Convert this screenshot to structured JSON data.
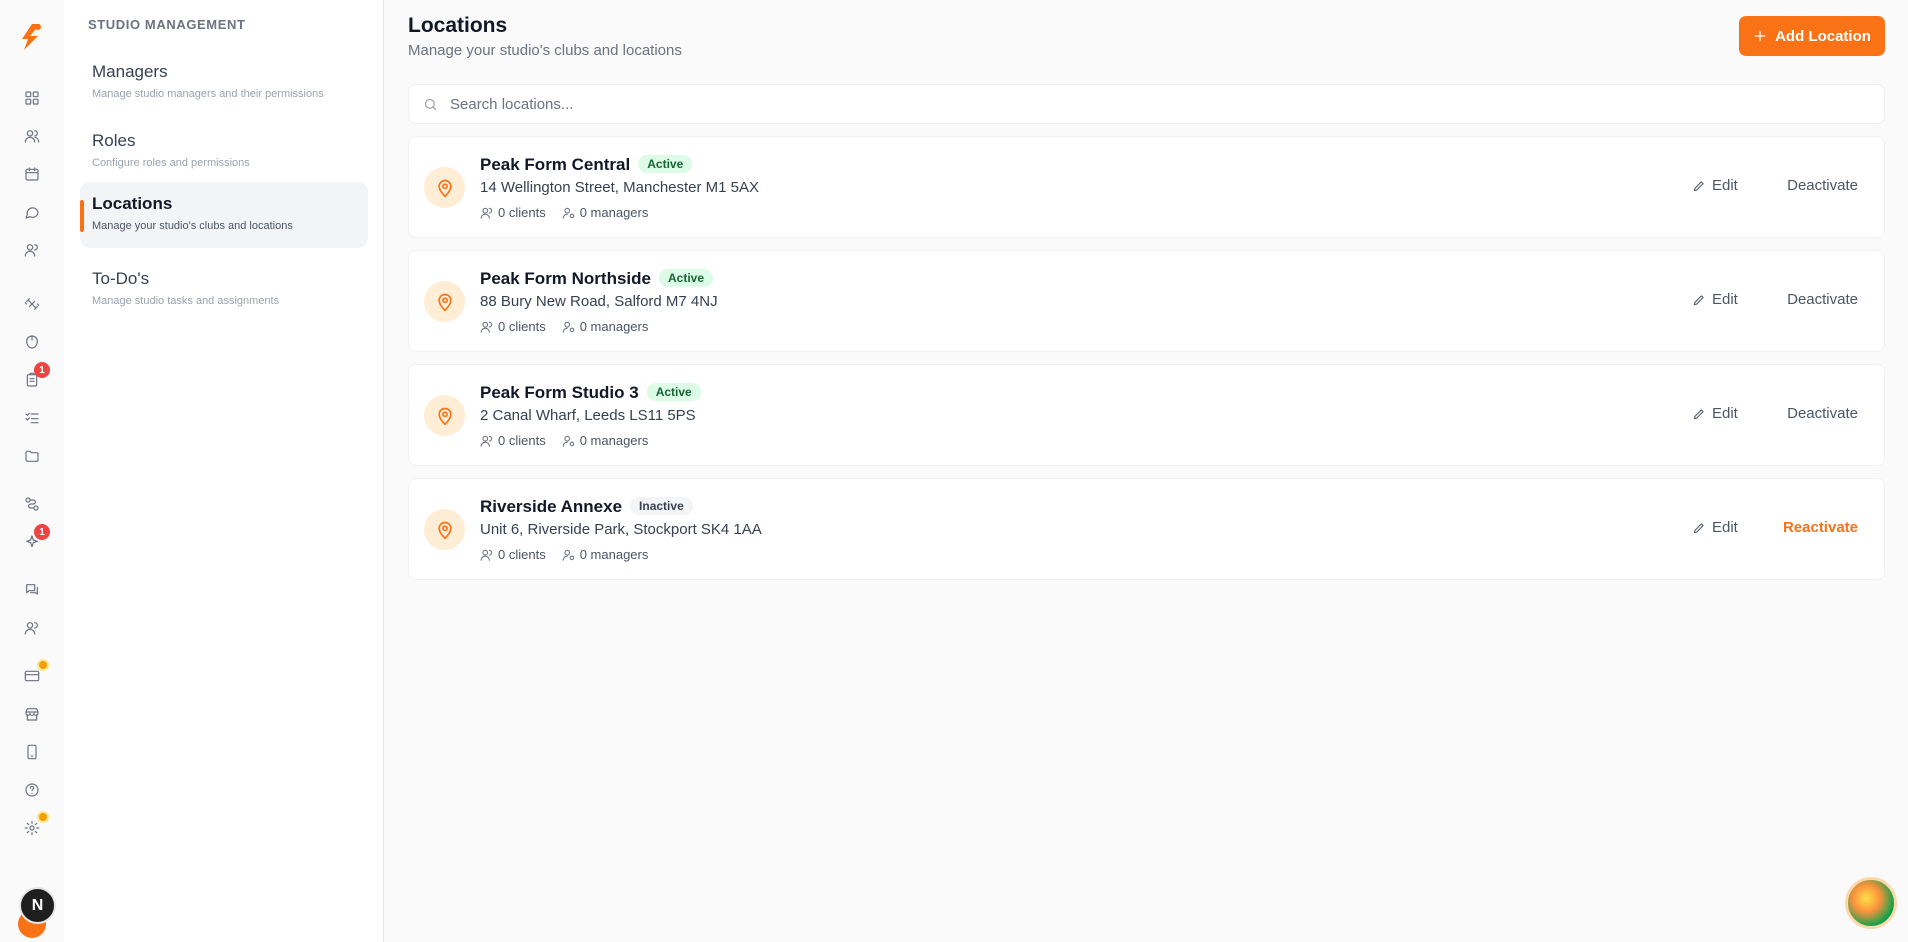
{
  "rail": {
    "icons": [
      "grid-icon",
      "users-icon",
      "calendar-icon",
      "chat-bubble-icon",
      "clients-icon",
      "dumbbell-icon",
      "nutrition-icon",
      "clipboard-icon",
      "checklist-icon",
      "folder-icon",
      "workflow-icon",
      "sparkles-icon",
      "messages-icon",
      "team-icon",
      "credit-card-icon",
      "store-icon",
      "mobile-icon",
      "help-icon",
      "settings-icon"
    ],
    "badges": {
      "clipboard": "1",
      "sparkles": "1"
    },
    "user_initial": "N",
    "accent_color": "#f97316"
  },
  "subnav": {
    "title": "STUDIO MANAGEMENT",
    "items": [
      {
        "label": "Managers",
        "desc": "Manage studio managers and their permissions"
      },
      {
        "label": "Roles",
        "desc": "Configure roles and permissions"
      },
      {
        "label": "Locations",
        "desc": "Manage your studio's clubs and locations"
      },
      {
        "label": "To-Do's",
        "desc": "Manage studio tasks and assignments"
      }
    ]
  },
  "header": {
    "title": "Locations",
    "subtitle": "Manage your studio's clubs and locations",
    "add_button": "Add Location"
  },
  "search": {
    "placeholder": "Search locations..."
  },
  "locations": [
    {
      "name": "Peak Form Central",
      "status": "Active",
      "address": "14 Wellington Street, Manchester M1 5AX",
      "clients": "0 clients",
      "managers": "0 managers",
      "edit": "Edit",
      "action": "Deactivate"
    },
    {
      "name": "Peak Form Northside",
      "status": "Active",
      "address": "88 Bury New Road, Salford M7 4NJ",
      "clients": "0 clients",
      "managers": "0 managers",
      "edit": "Edit",
      "action": "Deactivate"
    },
    {
      "name": "Peak Form Studio 3",
      "status": "Active",
      "address": "2 Canal Wharf, Leeds LS11 5PS",
      "clients": "0 clients",
      "managers": "0 managers",
      "edit": "Edit",
      "action": "Deactivate"
    },
    {
      "name": "Riverside Annexe",
      "status": "Inactive",
      "address": "Unit 6, Riverside Park, Stockport SK4 1AA",
      "clients": "0 clients",
      "managers": "0 managers",
      "edit": "Edit",
      "action": "Reactivate"
    }
  ]
}
